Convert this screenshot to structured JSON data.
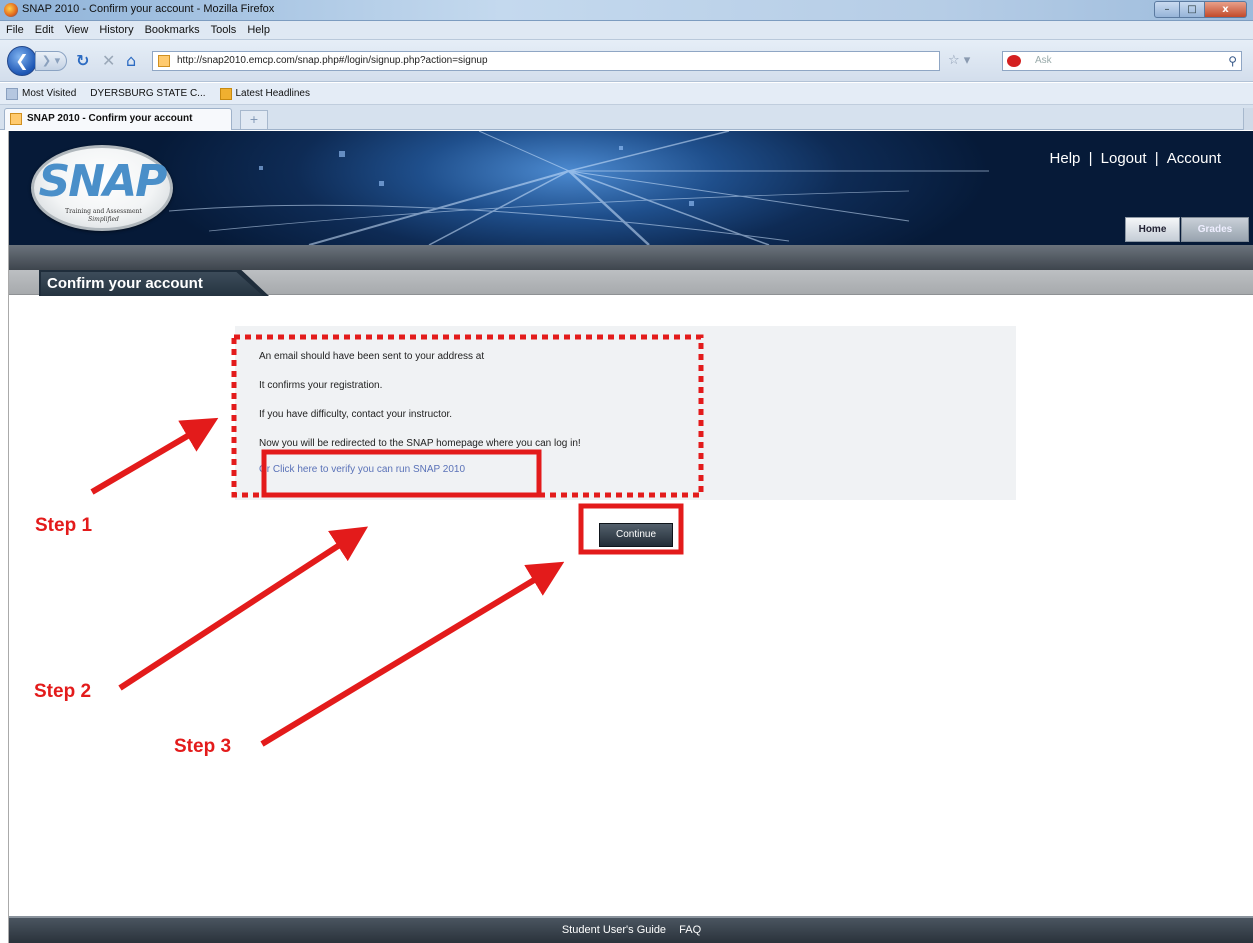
{
  "window": {
    "title": "SNAP 2010 - Confirm your account - Mozilla Firefox",
    "controls": {
      "minimize": "–",
      "maximize": "□",
      "close": "x"
    }
  },
  "menu": [
    "File",
    "Edit",
    "View",
    "History",
    "Bookmarks",
    "Tools",
    "Help"
  ],
  "toolbar": {
    "url": "http://snap2010.emcp.com/snap.php#/login/signup.php?action=signup",
    "search_placeholder": "Ask",
    "icons": [
      "back-icon",
      "forward-icon",
      "reload-icon",
      "stop-icon",
      "home-icon",
      "star-icon",
      "search-icon"
    ]
  },
  "bookmarks": [
    "Most Visited",
    "DYERSBURG STATE C...",
    "Latest Headlines"
  ],
  "tabs": [
    {
      "title": "SNAP 2010 - Confirm your account"
    }
  ],
  "new_tab_label": "+",
  "header": {
    "logo_text": "SNAP",
    "logo_tagline": "Training and Assessment",
    "logo_tagline2": "Simplified",
    "links": [
      "Help",
      "Logout",
      "Account"
    ],
    "separator": "|",
    "nav_tabs": [
      "Home",
      "Grades"
    ]
  },
  "page_title": "Confirm your account",
  "messages": [
    "An email should have been sent to your address at",
    "It confirms your registration.",
    "If you have difficulty, contact your instructor.",
    "Now you will be redirected to the SNAP homepage where you can log in!"
  ],
  "verify_prefix": "Or",
  "verify_link": "Click here to verify you can run SNAP 2010",
  "continue_label": "Continue",
  "footer_links": [
    "Student User's Guide",
    "FAQ"
  ],
  "annotations": {
    "steps": [
      "Step 1",
      "Step 2",
      "Step 3"
    ],
    "color": "#e31b1b"
  }
}
